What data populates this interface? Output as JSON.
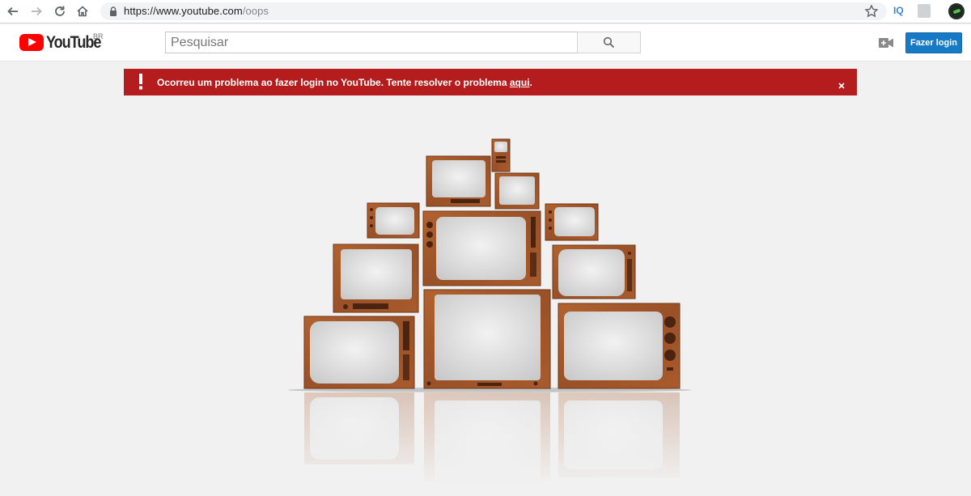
{
  "browser": {
    "url_host": "https://www.youtube.com",
    "url_path": "/oops",
    "extensions": {
      "iq_label": "IQ"
    }
  },
  "header": {
    "logo_text": "YouTube",
    "country_code": "BR",
    "search_placeholder": "Pesquisar",
    "login_label": "Fazer login"
  },
  "alert": {
    "message": "Ocorreu um problema ao fazer login no YouTube. Tente resolver o problema ",
    "link_text": "aqui",
    "period": ".",
    "background_color": "#b51c1d"
  },
  "icons": {
    "back": "back-arrow-icon",
    "forward": "forward-arrow-icon",
    "reload": "reload-icon",
    "home": "home-icon",
    "lock": "lock-icon",
    "bookmark": "star-icon",
    "search": "search-icon",
    "upload": "video-camera-plus-icon",
    "close": "close-icon",
    "alert": "exclamation-icon"
  },
  "colors": {
    "yt_red": "#ff0000",
    "login_blue": "#167ac6",
    "wood": "#a0552a"
  }
}
